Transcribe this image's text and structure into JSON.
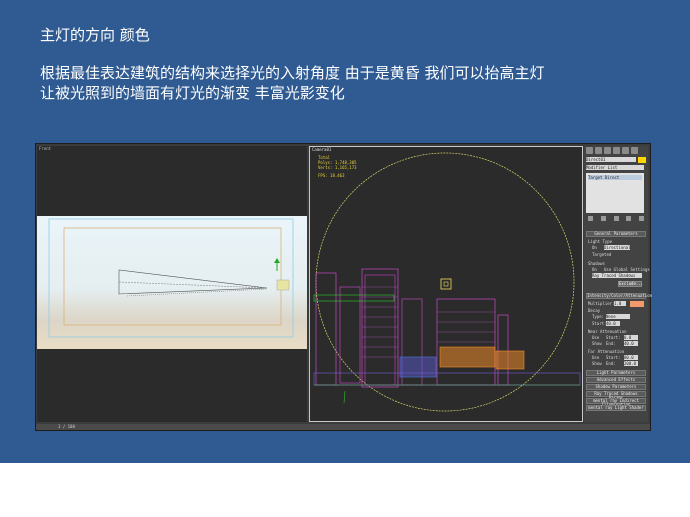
{
  "slide": {
    "title": "主灯的方向 颜色",
    "body_lines": [
      "根据最佳表达建筑的结构来选择光的入射角度 由于是黄昏 我们可以抬高主灯",
      "让被光照到的墙面有灯光的渐变 丰富光影变化"
    ]
  },
  "colors": {
    "slide_bg": "#2f5b92",
    "accent_yellow": "#ffd400",
    "light_color": "#f39a6a"
  },
  "app": {
    "left_viewport_label": "Front",
    "right_viewport_label": "Camera01",
    "stats": [
      "Total",
      "Polys: 1,748,305",
      "Verts: 1,165,173",
      "FPS: 18.463"
    ],
    "command_panel": {
      "name_field": "Direct01",
      "modifier_list": "Modifier List",
      "stack_item": "Target Direct",
      "rollouts": [
        "General Parameters",
        "Intensity/Color/Attenuation",
        "Light Parameters",
        "Advanced Effects",
        "Shadow Parameters",
        "Ray Traced Shadows Params",
        "mental ray Indirect Illumination",
        "mental ray Light Shader"
      ],
      "general_params": [
        "Light Type",
        "On",
        "Directional",
        "Targeted",
        "Shadows",
        "On",
        "Use Global Settings",
        "Ray Traced Shadows",
        "Exclude..."
      ],
      "intensity": {
        "label": "Multiplier:",
        "value": "1.0"
      },
      "decay": [
        "Decay",
        "Type:",
        "None",
        "Start:",
        "40.0"
      ],
      "near_atten": [
        "Near Attenuation",
        "Use",
        "Start:",
        "0.0",
        "Show",
        "End:",
        "40.0"
      ],
      "far_atten": [
        "Far Attenuation",
        "Use",
        "Start:",
        "80.0",
        "Show",
        "End:",
        "200.0"
      ]
    },
    "status": "1 / 100"
  }
}
